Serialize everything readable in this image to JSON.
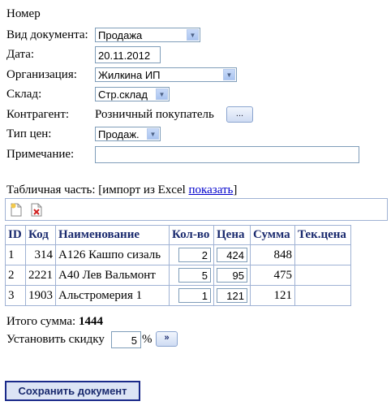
{
  "form": {
    "number_label": "Номер",
    "doc_type_label": "Вид документа:",
    "doc_type_value": "Продажа",
    "date_label": "Дата:",
    "date_value": "20.11.2012",
    "org_label": "Организация:",
    "org_value": "Жилкина ИП",
    "warehouse_label": "Склад:",
    "warehouse_value": "Стр.склад",
    "counterparty_label": "Контрагент:",
    "counterparty_value": "Розничный покупатель",
    "counterparty_button": "...",
    "price_type_label": "Тип цен:",
    "price_type_value": "Продаж.",
    "note_label": "Примечание:",
    "note_value": ""
  },
  "table_section": {
    "caption": "Табличная часть: [импорт из Excel ",
    "show_link": "показать",
    "caption_end": "]"
  },
  "table": {
    "headers": [
      "ID",
      "Код",
      "Наименование",
      "Кол-во",
      "Цена",
      "Сумма",
      "Тек.цена"
    ],
    "rows": [
      {
        "id": "1",
        "code": "314",
        "name": "А126 Кашпо сизаль",
        "qty": "2",
        "price": "424",
        "sum": "848",
        "cur_price": ""
      },
      {
        "id": "2",
        "code": "2221",
        "name": "А40 Лев Вальмонт",
        "qty": "5",
        "price": "95",
        "sum": "475",
        "cur_price": ""
      },
      {
        "id": "3",
        "code": "1903",
        "name": "Альстромерия 1",
        "qty": "1",
        "price": "121",
        "sum": "121",
        "cur_price": ""
      }
    ]
  },
  "totals": {
    "total_label": "Итого сумма: ",
    "total_value": "1444",
    "discount_label": "Установить скидку",
    "discount_value": "5",
    "percent": "%",
    "apply_button": "»"
  },
  "actions": {
    "save_label": "Сохранить документ"
  },
  "colors": {
    "header_text": "#1a2a6e",
    "border": "#9fb2d4",
    "link": "#0000cc"
  }
}
